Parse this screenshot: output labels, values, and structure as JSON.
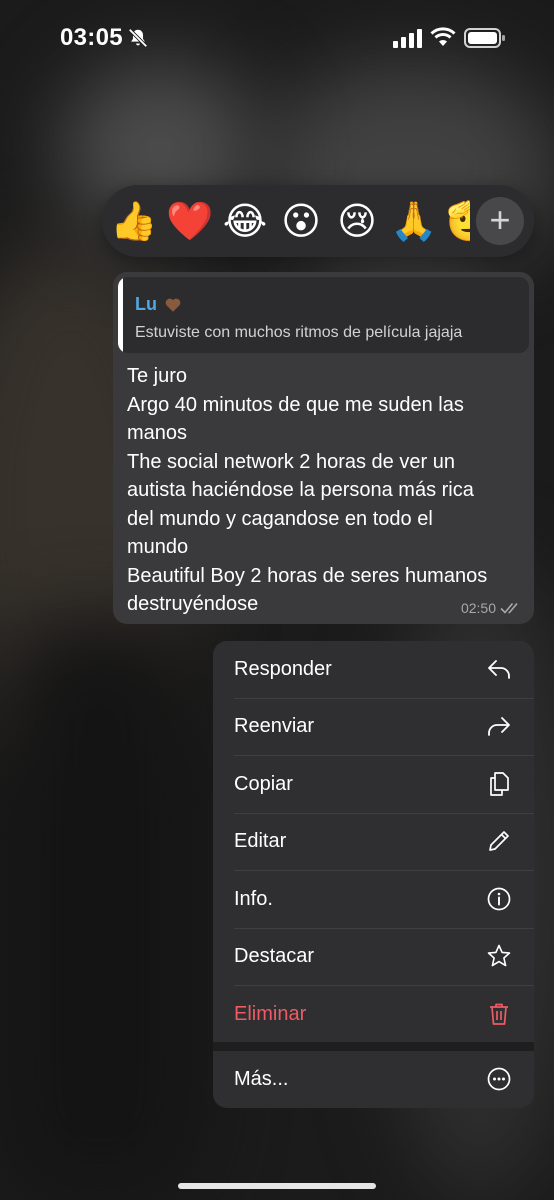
{
  "status_bar": {
    "time": "03:05"
  },
  "reactions": {
    "emojis": [
      "👍",
      "❤️",
      "😂",
      "😮",
      "😢",
      "🙏",
      "🫡"
    ],
    "more_label": "+"
  },
  "message": {
    "reply": {
      "name": "Lu",
      "text": "Estuviste con muchos ritmos de película jajaja"
    },
    "lines": [
      "Te juro",
      "Argo 40 minutos de que me suden las",
      "manos",
      "The social network 2 horas de ver un",
      "autista haciéndose la persona más rica",
      "del mundo y cagandose en todo el",
      "mundo",
      "Beautiful Boy 2 horas de seres humanos",
      "destruyéndose"
    ],
    "time": "02:50"
  },
  "menu": {
    "items": [
      {
        "label": "Responder",
        "icon": "reply-icon"
      },
      {
        "label": "Reenviar",
        "icon": "forward-icon"
      },
      {
        "label": "Copiar",
        "icon": "copy-icon"
      },
      {
        "label": "Editar",
        "icon": "pencil-icon"
      },
      {
        "label": "Info.",
        "icon": "info-icon"
      },
      {
        "label": "Destacar",
        "icon": "star-icon"
      },
      {
        "label": "Eliminar",
        "icon": "trash-icon"
      },
      {
        "label": "Más...",
        "icon": "more-icon"
      }
    ]
  },
  "colors": {
    "delete": "#ee5b64",
    "reply_name": "#53a7e0"
  }
}
